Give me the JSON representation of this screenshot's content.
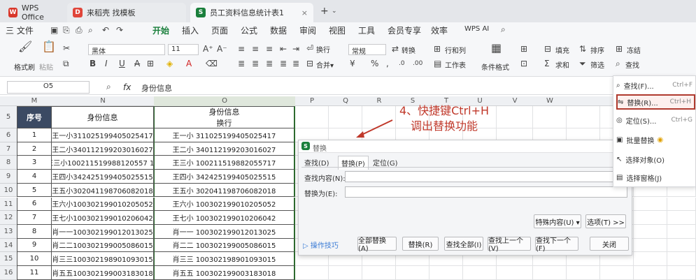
{
  "tabs": [
    {
      "label": "WPS Office"
    },
    {
      "label": "来稻壳 找模板"
    },
    {
      "label": "员工资料信息统计表1"
    }
  ],
  "menus": [
    "三 文件",
    "开始",
    "插入",
    "页面",
    "公式",
    "数据",
    "审阅",
    "视图",
    "工具",
    "会员专享",
    "效率",
    "WPS AI"
  ],
  "active_menu": "开始",
  "ribbon": {
    "format_painter": "格式刷",
    "paste": "粘贴",
    "font": "黑体",
    "size": "11",
    "wrap": "换行",
    "number_format": "常规",
    "convert": "转换",
    "rowcol": "行和列",
    "worksheet": "工作表",
    "cond_format": "条件格式",
    "fill": "填充",
    "sort": "排序",
    "freeze": "冻结",
    "sum": "求和",
    "filter": "筛选",
    "find": "查找"
  },
  "formula_bar": {
    "cell_ref": "O5",
    "fx": "fx",
    "value": "身份信息"
  },
  "columns": [
    "M",
    "N",
    "O",
    "P",
    "Q",
    "R",
    "S",
    "T",
    "U",
    "V",
    "W"
  ],
  "rows": [
    {
      "r": "5",
      "a": "序号",
      "b": "身份信息",
      "c": "身份信息\n换行"
    },
    {
      "r": "6",
      "a": "1",
      "b": "王一小311025199405025417",
      "c": "王一小 311025199405025417"
    },
    {
      "r": "7",
      "a": "2",
      "b": "王二小340112199203016027",
      "c": "王二小 340112199203016027"
    },
    {
      "r": "8",
      "a": "3",
      "b": "王三小100211519988120557 17",
      "c": "王三小 100211519882055717"
    },
    {
      "r": "9",
      "a": "4",
      "b": "王四小342425199405025515",
      "c": "王四小 342425199405025515"
    },
    {
      "r": "10",
      "a": "5",
      "b": "王五小302041198706082018",
      "c": "王五小 302041198706082018"
    },
    {
      "r": "11",
      "a": "6",
      "b": "王六小100302199010205052",
      "c": "王六小 100302199010205052"
    },
    {
      "r": "12",
      "a": "7",
      "b": "王七小100302199010206042",
      "c": "王七小 100302199010206042"
    },
    {
      "r": "13",
      "a": "8",
      "b": "肖一一100302199012013025",
      "c": "肖一一 100302199012013025"
    },
    {
      "r": "14",
      "a": "9",
      "b": "肖二二100302199005086015",
      "c": "肖二二 100302199005086015"
    },
    {
      "r": "15",
      "a": "10",
      "b": "肖三三100302198901093015",
      "c": "肖三三 100302198901093015"
    },
    {
      "r": "16",
      "a": "11",
      "b": "肖五五100302199003183018",
      "c": "肖五五 100302199003183018"
    }
  ],
  "annotation": {
    "line1": "4、快捷键Ctrl+H",
    "line2": "调出替换功能"
  },
  "dialog": {
    "title": "替换",
    "tabs": [
      "查找(D)",
      "替换(P)",
      "定位(G)"
    ],
    "find_label": "查找内容(N):",
    "replace_label": "替换为(E):",
    "special": "特殊内容(U) ▾",
    "options": "选项(T) >>",
    "tips": "操作技巧",
    "buttons": [
      "全部替换(A)",
      "替换(R)",
      "查找全部(I)",
      "查找上一个(V)",
      "查找下一个(F)",
      "关闭"
    ]
  },
  "dropdown": [
    {
      "label": "查找(F)...",
      "key": "Ctrl+F"
    },
    {
      "label": "替换(R)...",
      "key": "Ctrl+H"
    },
    {
      "label": "定位(S)...",
      "key": "Ctrl+G"
    },
    {
      "label": "批量替换",
      "key": ""
    },
    {
      "label": "选择对象(O)",
      "key": ""
    },
    {
      "label": "选择窗格(J)",
      "key": ""
    }
  ]
}
